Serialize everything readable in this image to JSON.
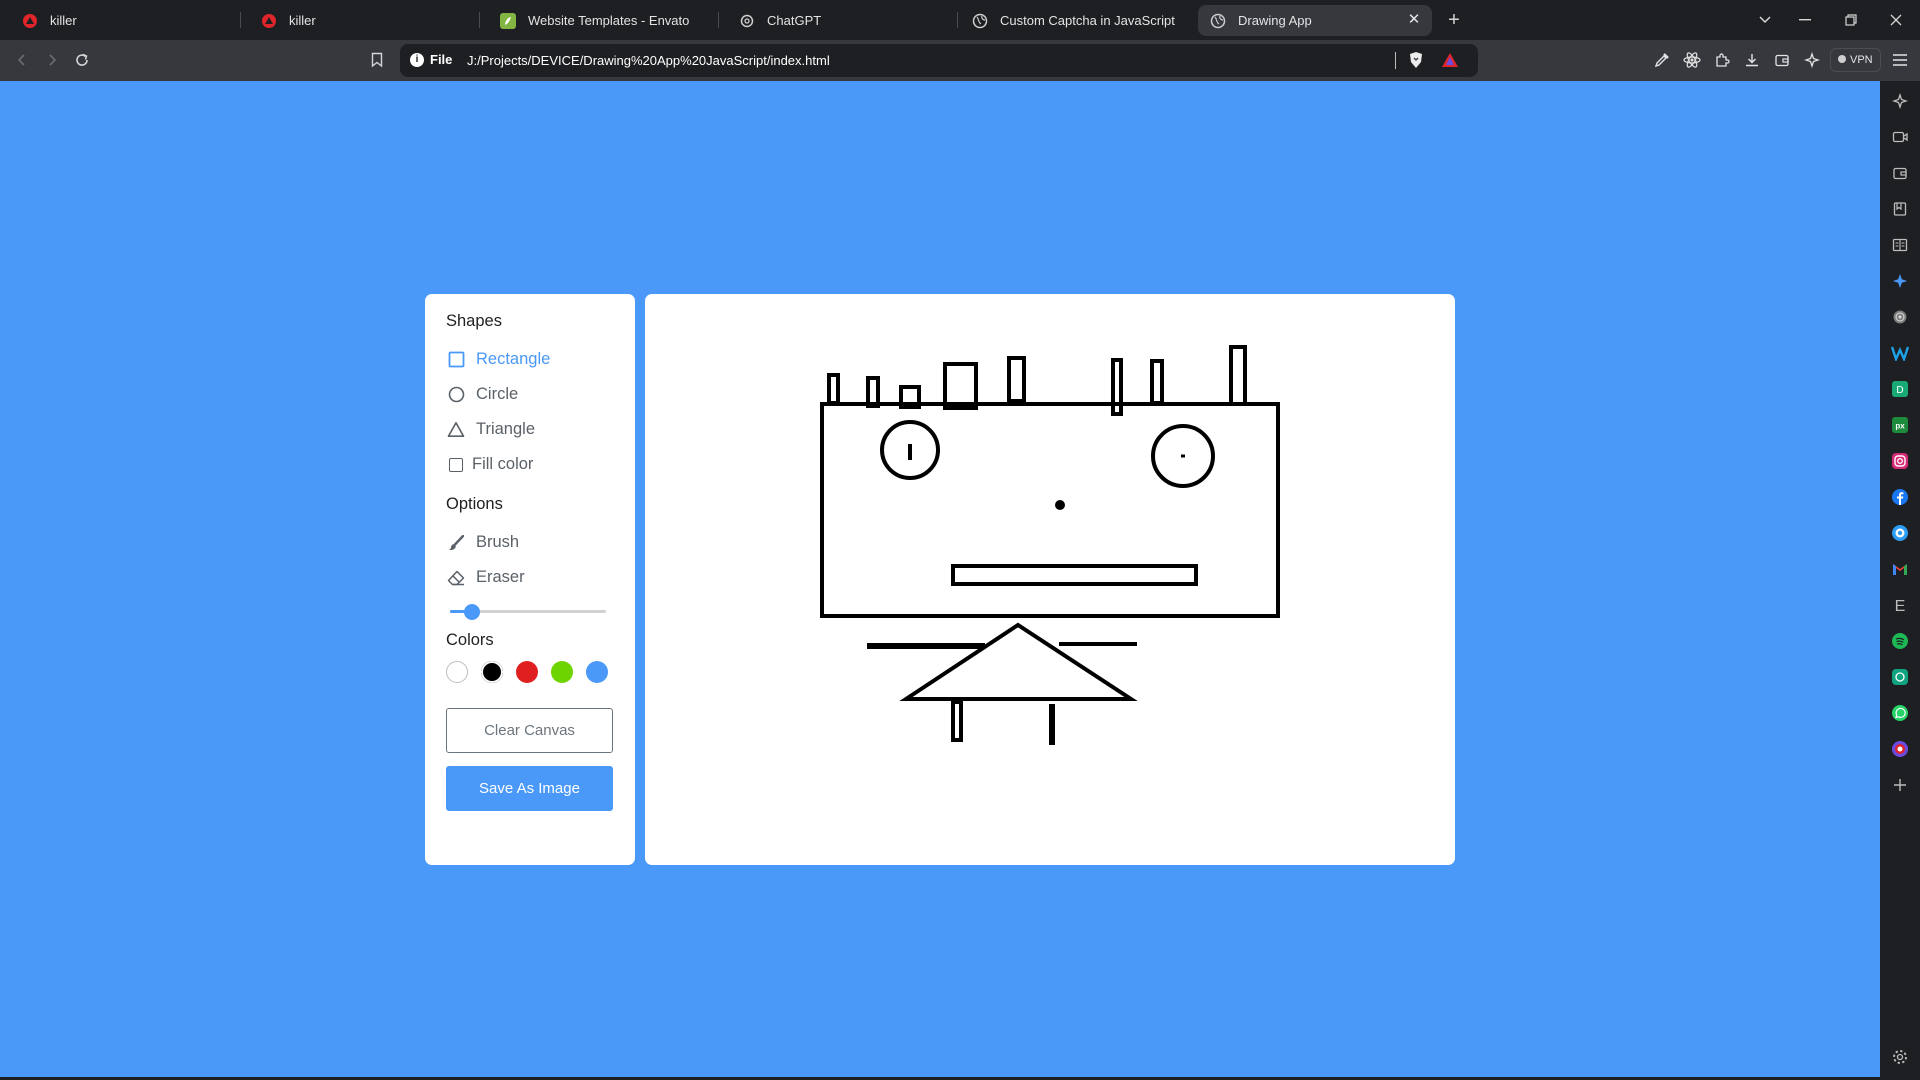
{
  "browser": {
    "tabs": [
      {
        "title": "killer",
        "favicon": "brand-logo-icon"
      },
      {
        "title": "killer",
        "favicon": "brand-logo-icon"
      },
      {
        "title": "Website Templates - Envato",
        "favicon": "envato-icon"
      },
      {
        "title": "ChatGPT",
        "favicon": "chatgpt-icon"
      },
      {
        "title": "Custom Captcha in JavaScript | Codi",
        "favicon": "globe-icon"
      },
      {
        "title": "Drawing App",
        "favicon": "globe-icon",
        "active": true
      }
    ],
    "url_scheme": "File",
    "url": "J:/Projects/DEVICE/Drawing%20App%20JavaScript/index.html",
    "vpn_label": "VPN"
  },
  "app": {
    "shapes_title": "Shapes",
    "shapes": [
      {
        "label": "Rectangle",
        "icon": "square-outline-icon",
        "active": true
      },
      {
        "label": "Circle",
        "icon": "circle-outline-icon"
      },
      {
        "label": "Triangle",
        "icon": "triangle-outline-icon"
      }
    ],
    "fill_label": "Fill color",
    "fill_checked": false,
    "options_title": "Options",
    "options": [
      {
        "label": "Brush",
        "icon": "brush-icon"
      },
      {
        "label": "Eraser",
        "icon": "eraser-icon"
      }
    ],
    "brush_size": {
      "min": 1,
      "max": 30,
      "value": 5
    },
    "colors_title": "Colors",
    "colors": [
      "#ffffff",
      "#000000",
      "#e02020",
      "#6dd400",
      "#4a98f7"
    ],
    "selected_color": "#000000",
    "clear_label": "Clear Canvas",
    "save_label": "Save As Image",
    "accent": "#4a98f7"
  }
}
